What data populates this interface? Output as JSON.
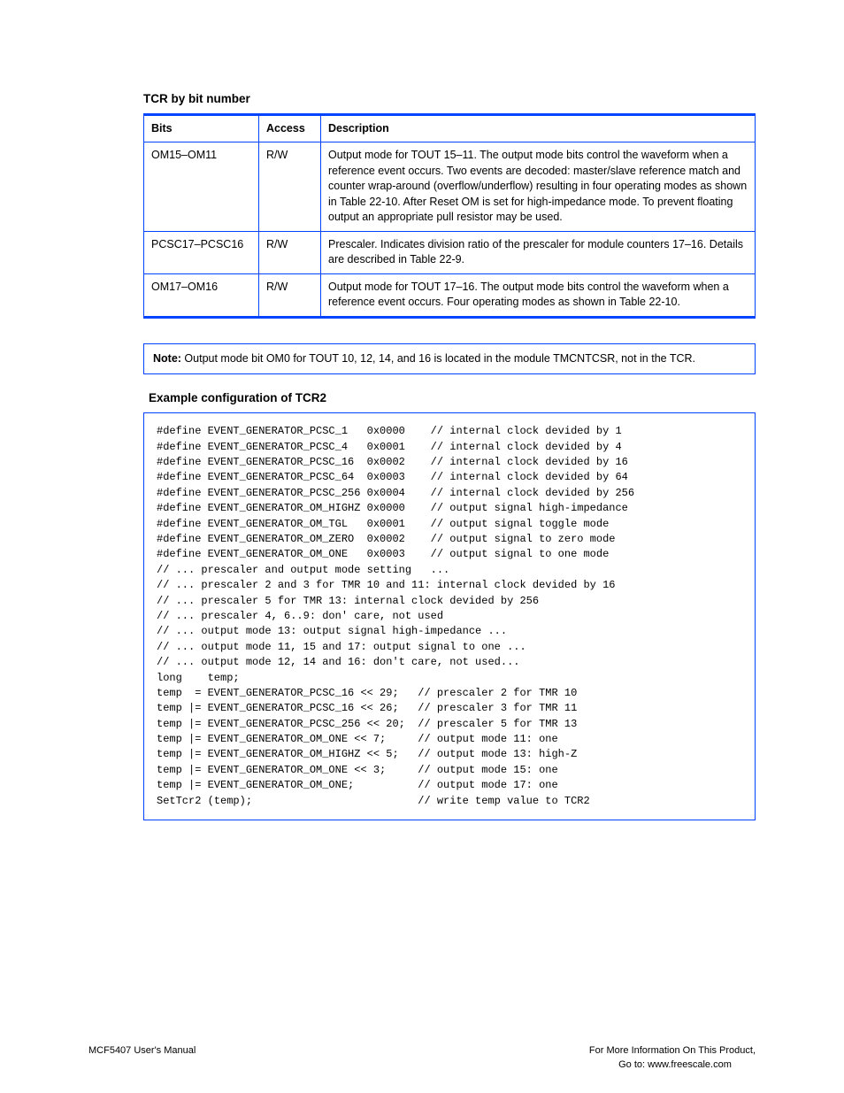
{
  "register": {
    "title": "TCR by bit number",
    "header": {
      "bits": "Bits",
      "access": "Access",
      "description": "Description"
    },
    "rows": [
      {
        "bits": "OM15–OM11",
        "access": "R/W",
        "desc": [
          "Output mode for TOUT 15–11. The output mode bits control the waveform when a reference event occurs. Two events are decoded: master/slave reference match and counter wrap-around (overflow/underflow) resulting in four operating modes as shown in Table 22-10. After Reset OM is set for high-impedance mode. To prevent floating output an appropriate pull resistor may be used."
        ]
      },
      {
        "bits": "PCSC17–PCSC16",
        "access": "R/W",
        "desc": [
          "Prescaler. Indicates division ratio of the prescaler for module counters 17–16. Details are described in Table 22-9."
        ]
      },
      {
        "bits": "OM17–OM16",
        "access": "R/W",
        "desc": [
          "Output mode for TOUT 17–16. The output mode bits control the waveform when a reference event occurs. Four operating modes as shown in Table 22-10."
        ]
      }
    ]
  },
  "note": {
    "label": "Note:",
    "text": " Output mode bit OM0 for TOUT 10, 12, 14, and 16 is located in the module TMCNTCSR, not in the TCR."
  },
  "example": {
    "title": "Example configuration of TCR2",
    "code": "#define EVENT_GENERATOR_PCSC_1   0x0000    // internal clock devided by 1\n#define EVENT_GENERATOR_PCSC_4   0x0001    // internal clock devided by 4\n#define EVENT_GENERATOR_PCSC_16  0x0002    // internal clock devided by 16\n#define EVENT_GENERATOR_PCSC_64  0x0003    // internal clock devided by 64\n#define EVENT_GENERATOR_PCSC_256 0x0004    // internal clock devided by 256\n#define EVENT_GENERATOR_OM_HIGHZ 0x0000    // output signal high-impedance\n#define EVENT_GENERATOR_OM_TGL   0x0001    // output signal toggle mode\n#define EVENT_GENERATOR_OM_ZERO  0x0002    // output signal to zero mode\n#define EVENT_GENERATOR_OM_ONE   0x0003    // output signal to one mode\n// ... prescaler and output mode setting   ...\n// ... prescaler 2 and 3 for TMR 10 and 11: internal clock devided by 16\n// ... prescaler 5 for TMR 13: internal clock devided by 256\n// ... prescaler 4, 6..9: don' care, not used\n// ... output mode 13: output signal high-impedance ...\n// ... output mode 11, 15 and 17: output signal to one ...\n// ... output mode 12, 14 and 16: don't care, not used...\nlong    temp;\ntemp  = EVENT_GENERATOR_PCSC_16 << 29;   // prescaler 2 for TMR 10\ntemp |= EVENT_GENERATOR_PCSC_16 << 26;   // prescaler 3 for TMR 11\ntemp |= EVENT_GENERATOR_PCSC_256 << 20;  // prescaler 5 for TMR 13\ntemp |= EVENT_GENERATOR_OM_ONE << 7;     // output mode 11: one\ntemp |= EVENT_GENERATOR_OM_HIGHZ << 5;   // output mode 13: high-Z\ntemp |= EVENT_GENERATOR_OM_ONE << 3;     // output mode 15: one\ntemp |= EVENT_GENERATOR_OM_ONE;          // output mode 17: one\nSetTcr2 (temp);                          // write temp value to TCR2"
  },
  "footer": {
    "left": "MCF5407 User's Manual",
    "right": "For More Information On This Product,\n  Go to: www.freescale.com"
  }
}
